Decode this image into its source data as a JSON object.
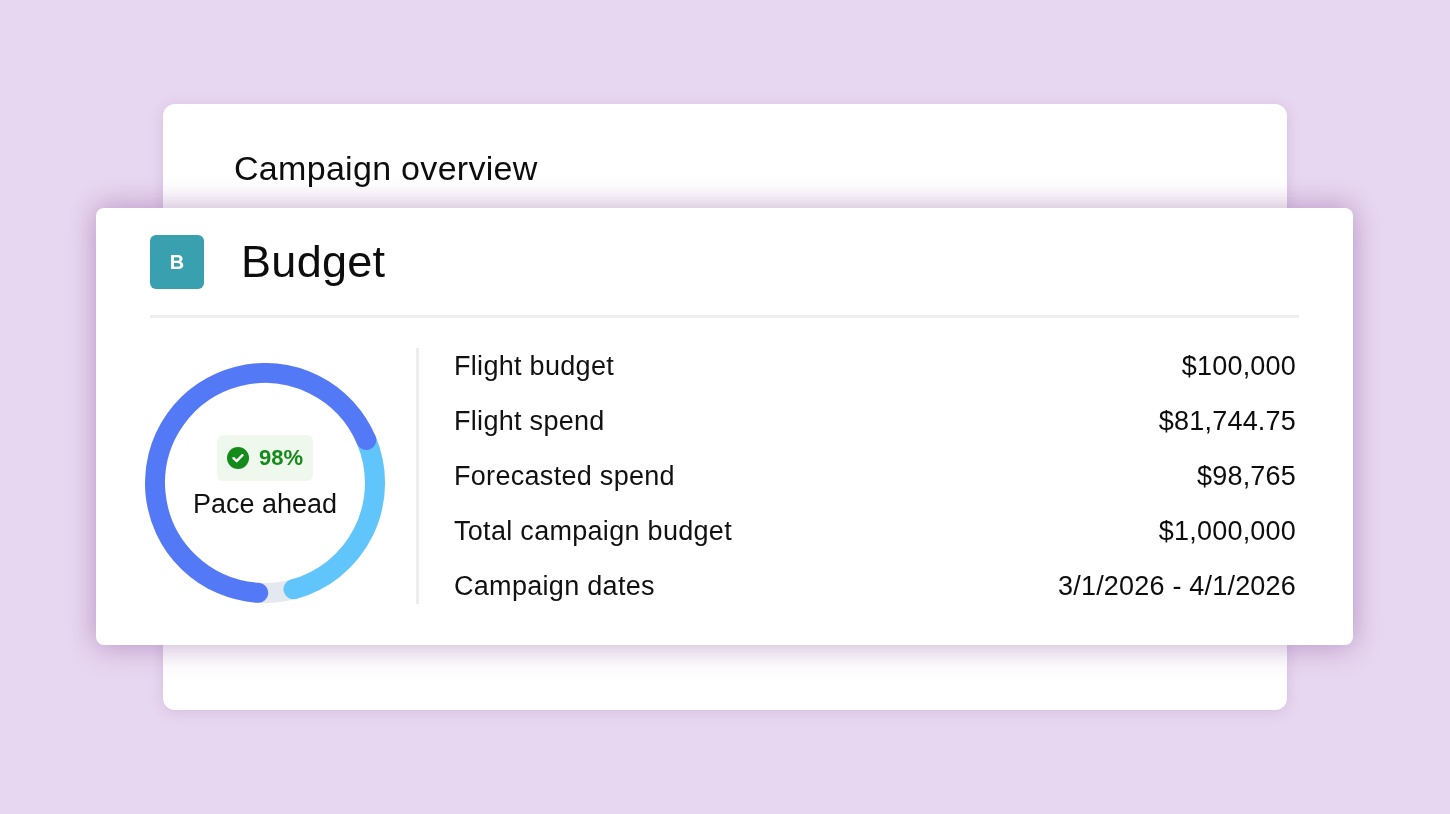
{
  "overview": {
    "title": "Campaign overview"
  },
  "budget_card": {
    "initial": "B",
    "title": "Budget",
    "pace": {
      "on_track": true,
      "value": "98%",
      "label": "Pace ahead"
    },
    "rows": [
      {
        "label": "Flight budget",
        "value": "$100,000"
      },
      {
        "label": "Flight spend",
        "value": "$81,744.75"
      },
      {
        "label": "Forecasted spend",
        "value": "$98,765"
      },
      {
        "label": "Total campaign budget",
        "value": "$1,000,000"
      },
      {
        "label": "Campaign dates",
        "value": "3/1/2026 - 4/1/2026"
      }
    ]
  }
}
